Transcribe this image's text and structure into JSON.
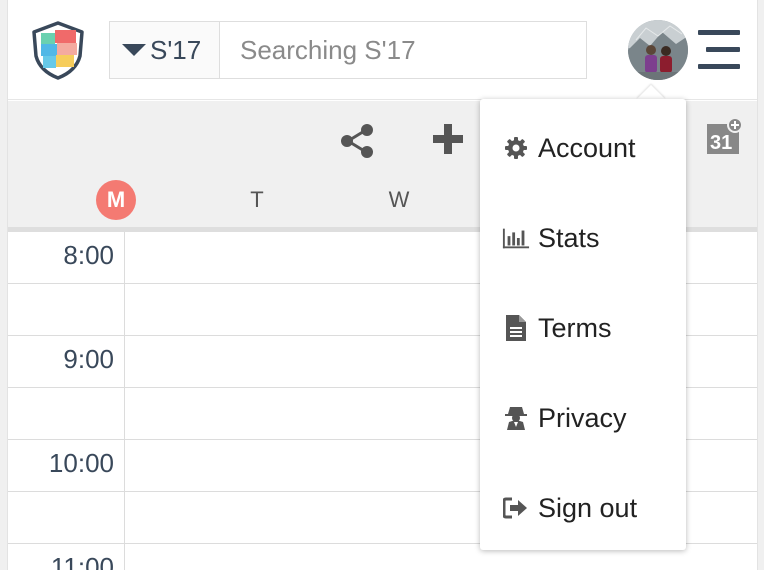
{
  "header": {
    "term_label": "S'17",
    "search_placeholder": "Searching S'17"
  },
  "toolbar": {
    "days": [
      {
        "label": "M",
        "today": true
      },
      {
        "label": "T",
        "today": false
      },
      {
        "label": "W",
        "today": false
      }
    ]
  },
  "calendar": {
    "time_labels": [
      "8:00",
      "",
      "9:00",
      "",
      "10:00",
      "",
      "11:00"
    ]
  },
  "menu": {
    "items": [
      {
        "label": "Account",
        "icon": "gear-icon"
      },
      {
        "label": "Stats",
        "icon": "bar-chart-icon"
      },
      {
        "label": "Terms",
        "icon": "document-icon"
      },
      {
        "label": "Privacy",
        "icon": "spy-icon"
      },
      {
        "label": "Sign out",
        "icon": "sign-out-icon"
      }
    ]
  },
  "colors": {
    "accent_navy": "#39485a",
    "today_badge": "#f47a72",
    "panel_gray": "#f0f0f0"
  }
}
